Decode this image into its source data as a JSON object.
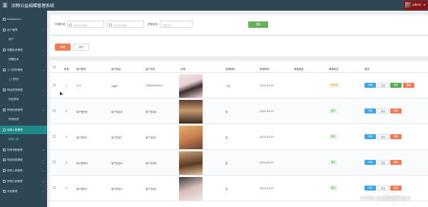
{
  "header": {
    "title": "旧物公益捐赠管理系统",
    "user_name": "admin"
  },
  "sidebar": {
    "items": [
      {
        "label": "Dashboard",
        "type": "top"
      },
      {
        "label": "用户管理",
        "type": "group"
      },
      {
        "label": "用户",
        "type": "sub"
      },
      {
        "label": "捐赠技术管理",
        "type": "group"
      },
      {
        "label": "捐赠技术",
        "type": "sub"
      },
      {
        "label": "上门揽件管理",
        "type": "group"
      },
      {
        "label": "上门揽件",
        "type": "sub"
      },
      {
        "label": "物品类型管理",
        "type": "group"
      },
      {
        "label": "物品类型",
        "type": "sub"
      },
      {
        "label": "物资信息管理",
        "type": "group"
      },
      {
        "label": "物资信息",
        "type": "sub"
      },
      {
        "label": "转捐人群管理",
        "type": "group-active"
      },
      {
        "label": "转捐人群",
        "type": "sub-active"
      },
      {
        "label": "物资领取管理",
        "type": "group"
      },
      {
        "label": "物品回收管理",
        "type": "group"
      },
      {
        "label": "物资入库管理",
        "type": "group"
      },
      {
        "label": "物资出库管理",
        "type": "group"
      },
      {
        "label": "系统管理",
        "type": "group"
      }
    ]
  },
  "search": {
    "date_label": "申请时间",
    "date_start_placeholder": "申请时间起始",
    "date_end_placeholder": "申请时间结束",
    "status_label": "审核状态",
    "status_placeholder": "审核状态",
    "button": "搜索"
  },
  "actions": {
    "add": "新增",
    "delete": "删除"
  },
  "table": {
    "headers": [
      "序号",
      "用户账号",
      "用户姓名",
      "用户手机",
      "头像",
      "证明材料",
      "申请时间",
      "审核回复",
      "审核状态",
      "操作"
    ],
    "rows": [
      {
        "index": "1",
        "account": "111",
        "name": "ls用户",
        "phone": "13800000000",
        "proof": "下载",
        "date": "2024-03-13",
        "reply": "",
        "status": "待审核",
        "status_kind": "pending",
        "ops": [
          "详情",
          "修改",
          "审核",
          "删除"
        ]
      },
      {
        "index": "2",
        "account": "用户账号8",
        "name": "用户姓名8",
        "phone": "用户手机8",
        "proof": "无",
        "date": "2024-03-13",
        "reply": "",
        "status": "通过",
        "status_kind": "pass",
        "ops": [
          "详情",
          "修改",
          "删除"
        ]
      },
      {
        "index": "3",
        "account": "用户账号7",
        "name": "用户姓名7",
        "phone": "用户手机7",
        "proof": "无",
        "date": "2024-03-13",
        "reply": "",
        "status": "通过",
        "status_kind": "pass",
        "ops": [
          "详情",
          "修改",
          "删除"
        ]
      },
      {
        "index": "4",
        "account": "用户账号6",
        "name": "用户姓名6",
        "phone": "用户手机6",
        "proof": "无",
        "date": "2024-03-13",
        "reply": "",
        "status": "通过",
        "status_kind": "pass",
        "ops": [
          "详情",
          "修改",
          "删除"
        ]
      },
      {
        "index": "5",
        "account": "用户账号5",
        "name": "用户姓名5",
        "phone": "用户手机5",
        "proof": "无",
        "date": "2024-03-13",
        "reply": "",
        "status": "通过",
        "status_kind": "pass",
        "ops": [
          "详情",
          "修改",
          "删除"
        ]
      }
    ]
  },
  "watermark": "CSDN @成都程序设计",
  "colors": {
    "sidebar_bg": "#2f4655",
    "accent_teal": "#1e8a8a",
    "primary_blue": "#3fa6e8",
    "success_green": "#5aaa56",
    "danger_orange": "#f07a56",
    "user_badge": "#8c1414"
  }
}
